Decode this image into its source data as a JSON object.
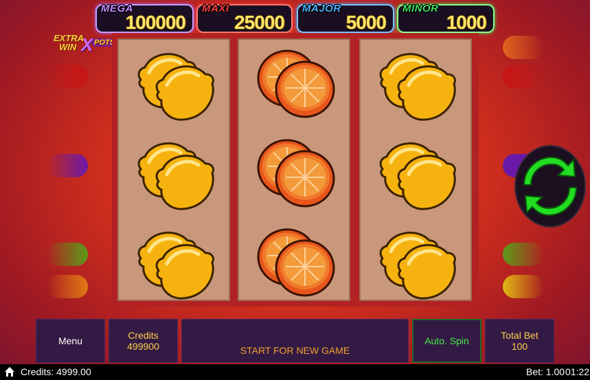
{
  "jackpots": [
    {
      "label": "MEGA",
      "value": "100000",
      "color": "#b56cff"
    },
    {
      "label": "MAXI",
      "value": "25000",
      "color": "#ff3a3a"
    },
    {
      "label": "MAJOR",
      "value": "5000",
      "color": "#3ea0ff"
    },
    {
      "label": "MINOR",
      "value": "1000",
      "color": "#3ee05a"
    }
  ],
  "logo": {
    "line1": "EXTRA",
    "line2": "WIN",
    "x": "X",
    "pots": "POTS"
  },
  "reels": [
    [
      "lemon",
      "lemon",
      "lemon"
    ],
    [
      "orange",
      "orange",
      "orange"
    ],
    [
      "lemon",
      "lemon",
      "lemon"
    ]
  ],
  "panel": {
    "menu": "Menu",
    "credits_label": "Credits",
    "credits_value": "499900",
    "message": "START FOR NEW GAME",
    "auto_spin": "Auto. Spin",
    "total_bet_label": "Total Bet",
    "total_bet_value": "100"
  },
  "status": {
    "credits": "Credits: 4999.00",
    "bet": "Bet: 1.00",
    "time": "01:22"
  },
  "colors": {
    "spin_green": "#22dd22",
    "reel_bg": "#c9977b",
    "panel_bg": "#331a44"
  }
}
